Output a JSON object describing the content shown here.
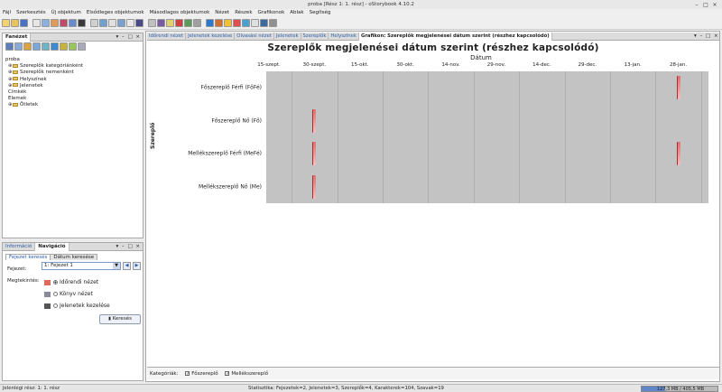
{
  "window": {
    "title": "proba [Rész 1: 1. rész] - oStorybook 4.10.2"
  },
  "menu": [
    "Fájl",
    "Szerkesztés",
    "Új objektum",
    "Elsődleges objektumok",
    "Másodlagos objektumok",
    "Nézet",
    "Részek",
    "Grafikonok",
    "Ablak",
    "Segítség"
  ],
  "tree_panel": {
    "title": "Fanézet",
    "items": [
      {
        "label": "proba",
        "level": 0,
        "folder": false
      },
      {
        "label": "Szereplők kategóriánként",
        "level": 1,
        "folder": true
      },
      {
        "label": "Szereplők nemenként",
        "level": 1,
        "folder": true
      },
      {
        "label": "Helyszínek",
        "level": 1,
        "folder": true
      },
      {
        "label": "Jelenetek",
        "level": 1,
        "folder": true
      },
      {
        "label": "Címkék",
        "level": 1,
        "folder": false
      },
      {
        "label": "Elemek",
        "level": 1,
        "folder": false
      },
      {
        "label": "Ötletek",
        "level": 1,
        "folder": true
      }
    ]
  },
  "nav_panel": {
    "tabs": [
      "Információ",
      "Navigáció"
    ],
    "subtabs": [
      "Fejezet keresés",
      "Dátum keresése"
    ],
    "chapter_label": "Fejezet:",
    "chapter_value": "1: Fejezet 1",
    "view_label": "Megtekintés:",
    "views": [
      {
        "label": "Időrendi nézet",
        "selected": true
      },
      {
        "label": "Könyv nézet",
        "selected": false
      },
      {
        "label": "Jelenetek kezelése",
        "selected": false
      }
    ],
    "search_button": "Keresés"
  },
  "doc_tabs": [
    "Időrendi nézet",
    "Jelenetek kezelése",
    "Olvasási nézet",
    "Jelenetek",
    "Szereplők",
    "Helyszínek",
    "Grafikon: Szereplők megjelenései dátum szerint (részhez kapcsolódó)"
  ],
  "chart_data": {
    "type": "scatter",
    "title": "Szereplők megjelenései dátum szerint (részhez kapcsolódó)",
    "xlabel": "Dátum",
    "ylabel": "Szereplő",
    "x_ticks": [
      "15-szept.",
      "30-szept.",
      "15-okt.",
      "30-okt.",
      "14-nov.",
      "29-nov.",
      "14-dec.",
      "29-dec.",
      "13-jan.",
      "28-jan."
    ],
    "categories": [
      "Főszereplő Férfi (FőFé)",
      "Főszereplő Nő (Fő)",
      "Mellékszereplő Férfi (MeFé)",
      "Mellékszereplő Nő (Me)"
    ],
    "points": [
      {
        "category": "Főszereplő Férfi (FőFé)",
        "x": "28-jan."
      },
      {
        "category": "Főszereplő Nő (Fő)",
        "x": "30-szept."
      },
      {
        "category": "Mellékszereplő Férfi (MeFé)",
        "x": "30-szept."
      },
      {
        "category": "Mellékszereplő Férfi (MeFé)",
        "x": "28-jan."
      },
      {
        "category": "Mellékszereplő Nő (Me)",
        "x": "30-szept."
      }
    ],
    "colors": {
      "marker": "#e07070",
      "plot_bg": "#c3c3c3"
    },
    "grid": true
  },
  "legend": {
    "label": "Kategóriák:",
    "items": [
      "Főszereplő",
      "Mellékszereplő"
    ]
  },
  "status": {
    "left": "Jelenlegi rész: 1: 1. rész",
    "stats": "Statisztika: Fejezetek=2,  Jelenetek=3,  Szereplők=4,  Karakterek=104,  Szavak=19",
    "memory": "127,3 MB / 405,5 MB",
    "memory_fraction": 0.314
  }
}
